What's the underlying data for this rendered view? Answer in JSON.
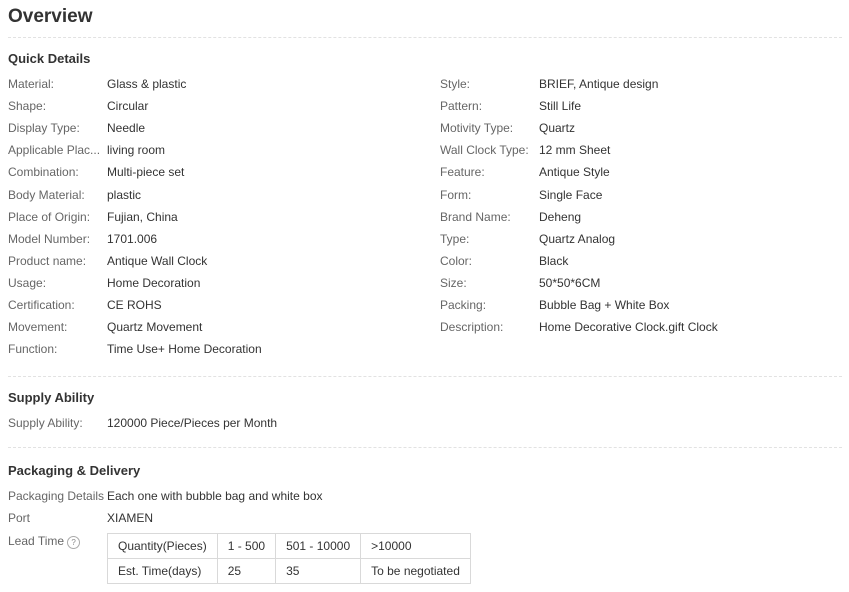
{
  "page_title": "Overview",
  "quick_details": {
    "title": "Quick Details",
    "left": [
      {
        "label": "Material:",
        "value": "Glass & plastic"
      },
      {
        "label": "Shape:",
        "value": "Circular"
      },
      {
        "label": "Display Type:",
        "value": "Needle"
      },
      {
        "label": "Applicable Plac...",
        "value": "living room"
      },
      {
        "label": "Combination:",
        "value": "Multi-piece set"
      },
      {
        "label": "Body Material:",
        "value": "plastic"
      },
      {
        "label": "Place of Origin:",
        "value": "Fujian, China"
      },
      {
        "label": "Model Number:",
        "value": "1701.006"
      },
      {
        "label": "Product name:",
        "value": "Antique Wall Clock"
      },
      {
        "label": "Usage:",
        "value": "Home Decoration"
      },
      {
        "label": "Certification:",
        "value": "CE ROHS"
      },
      {
        "label": "Movement:",
        "value": "Quartz Movement"
      },
      {
        "label": "Function:",
        "value": "Time Use+ Home Decoration"
      }
    ],
    "right": [
      {
        "label": "Style:",
        "value": "BRIEF, Antique design"
      },
      {
        "label": "Pattern:",
        "value": "Still Life"
      },
      {
        "label": "Motivity Type:",
        "value": "Quartz"
      },
      {
        "label": "Wall Clock Type:",
        "value": "12 mm Sheet"
      },
      {
        "label": "Feature:",
        "value": "Antique Style"
      },
      {
        "label": "Form:",
        "value": "Single Face"
      },
      {
        "label": "Brand Name:",
        "value": "Deheng"
      },
      {
        "label": "Type:",
        "value": "Quartz Analog"
      },
      {
        "label": "Color:",
        "value": "Black"
      },
      {
        "label": "Size:",
        "value": "50*50*6CM"
      },
      {
        "label": "Packing:",
        "value": "Bubble Bag + White Box"
      },
      {
        "label": "Description:",
        "value": "Home Decorative Clock.gift Clock"
      }
    ]
  },
  "supply": {
    "title": "Supply Ability",
    "label": "Supply Ability:",
    "value": "120000 Piece/Pieces per Month"
  },
  "packaging": {
    "title": "Packaging & Delivery",
    "details_label": "Packaging Details",
    "details_value": "Each one with bubble bag and white box",
    "port_label": "Port",
    "port_value": "XIAMEN",
    "lead_label": "Lead Time",
    "help_glyph": "?",
    "lead_table": {
      "row1": [
        "Quantity(Pieces)",
        "1 - 500",
        "501 - 10000",
        ">10000"
      ],
      "row2": [
        "Est. Time(days)",
        "25",
        "35",
        "To be negotiated"
      ]
    }
  }
}
